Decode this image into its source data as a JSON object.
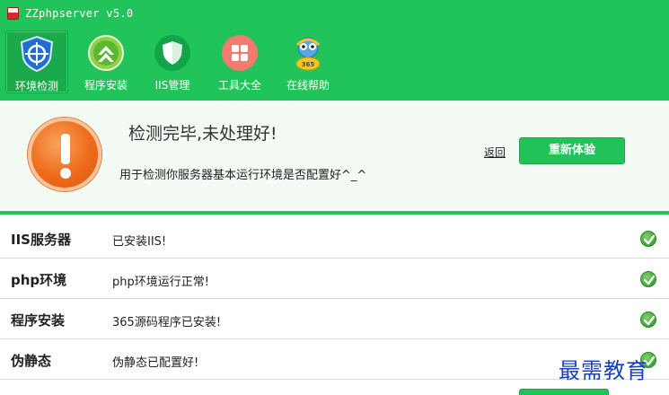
{
  "window": {
    "title": "ZZphpserver v5.0"
  },
  "toolbar": {
    "items": [
      {
        "label": "环境检测",
        "icon": "shield-crosshair-icon",
        "active": true
      },
      {
        "label": "程序安装",
        "icon": "upgrade-arrow-icon",
        "active": false
      },
      {
        "label": "IIS管理",
        "icon": "shield-check-icon",
        "active": false
      },
      {
        "label": "工具大全",
        "icon": "grid-tools-icon",
        "active": false
      },
      {
        "label": "在线帮助",
        "icon": "mascot-help-icon",
        "active": false
      }
    ]
  },
  "status": {
    "title": "检测完毕,未处理好!",
    "description": "用于检测你服务器基本运行环境是否配置好^_^",
    "back_link": "返回",
    "retry_button": "重新体验",
    "icon": "warning-exclamation-icon"
  },
  "checks": [
    {
      "name": "IIS服务器",
      "message": "已安装IIS!",
      "status_icon": "check-icon"
    },
    {
      "name": "php环境",
      "message": "php环境运行正常!",
      "status_icon": "check-icon"
    },
    {
      "name": "程序安装",
      "message": "365源码程序已安装!",
      "status_icon": "check-icon"
    },
    {
      "name": "伪静态",
      "message": "伪静态已配置好!",
      "status_icon": "check-icon"
    }
  ],
  "watermark": "最需教育",
  "colors": {
    "brand_green": "#21c45a",
    "warning_orange": "#ee6b1c",
    "check_green": "#3ea53a",
    "watermark_blue": "#1a3fb8"
  }
}
